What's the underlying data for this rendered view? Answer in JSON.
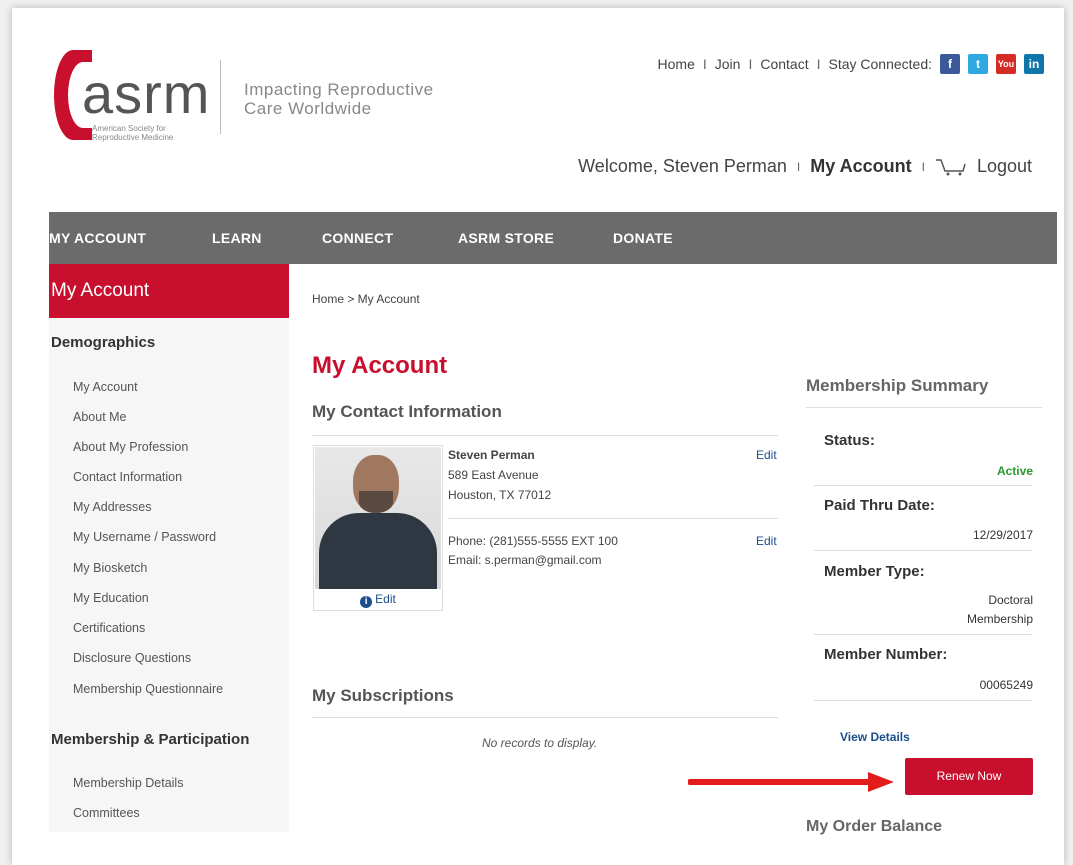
{
  "logo": {
    "word": "asrm",
    "subtitle": "American Society for Reproductive Medicine"
  },
  "tagline": "Impacting Reproductive Care Worldwide",
  "topnav": {
    "home": "Home",
    "join": "Join",
    "contact": "Contact",
    "stay_connected": "Stay Connected:",
    "sep": "I",
    "social": {
      "facebook": "f",
      "twitter": "t",
      "youtube": "You",
      "linkedin": "in"
    }
  },
  "welcome": {
    "greeting": "Welcome, Steven Perman",
    "my_account": "My Account",
    "logout": "Logout",
    "sep": "I"
  },
  "mainnav": [
    "MY ACCOUNT",
    "LEARN",
    "CONNECT",
    "ASRM STORE",
    "DONATE"
  ],
  "sidebar": {
    "header": "My Account",
    "section1": "Demographics",
    "items1": [
      "My Account",
      "About Me",
      "About My Profession",
      "Contact Information",
      "My Addresses",
      "My Username / Password",
      "My Biosketch",
      "My Education",
      "Certifications",
      "Disclosure Questions",
      "Membership Questionnaire"
    ],
    "section2": "Membership & Participation",
    "items2": [
      "Membership Details",
      "Committees"
    ]
  },
  "breadcrumb": "Home > My Account",
  "page_title": "My Account",
  "contact": {
    "heading": "My Contact Information",
    "name": "Steven Perman",
    "address1": "589 East Avenue",
    "address2": "Houston, TX  77012",
    "phone": "Phone: (281)555-5555 EXT 100",
    "email": "Email: s.perman@gmail.com",
    "edit": "Edit",
    "photo_edit": "Edit"
  },
  "subscriptions": {
    "heading": "My Subscriptions",
    "empty": "No records to display."
  },
  "summary": {
    "title": "Membership Summary",
    "status_label": "Status:",
    "status_value": "Active",
    "paid_label": "Paid Thru Date:",
    "paid_value": "12/29/2017",
    "type_label": "Member Type:",
    "type_value1": "Doctoral",
    "type_value2": "Membership",
    "number_label": "Member Number:",
    "number_value": "00065249",
    "view_details": "View Details",
    "renew": "Renew Now"
  },
  "order_balance": "My Order Balance",
  "colors": {
    "brand_red": "#c8102e",
    "nav_gray": "#6b6b6b",
    "link_blue": "#1a4f8b",
    "status_green": "#2a9a2a"
  }
}
